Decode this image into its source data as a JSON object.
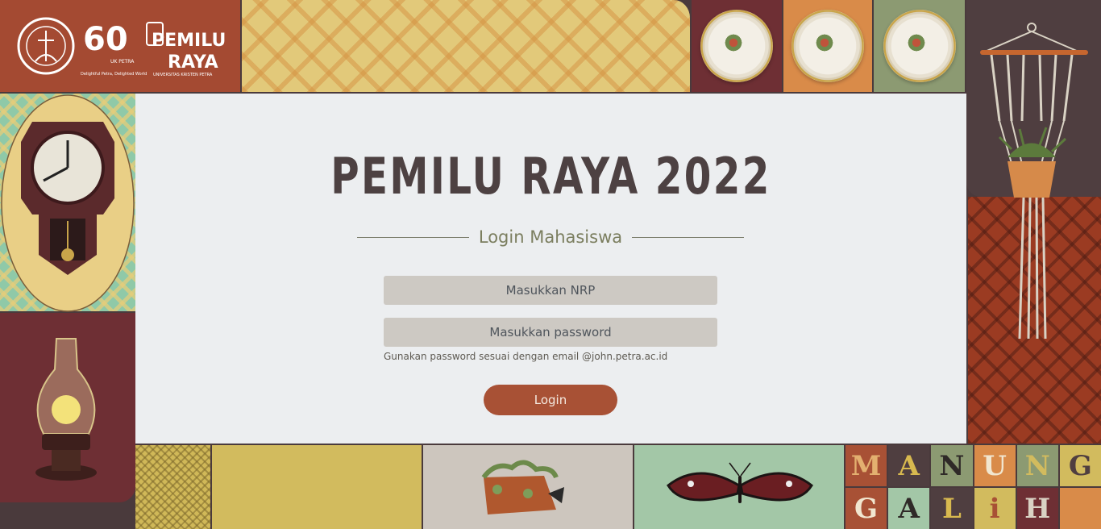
{
  "header": {
    "logos": [
      {
        "icon": "university-seal-icon",
        "text": "UNIVERSITAS KRISTEN PETRA"
      },
      {
        "icon": "sixty-anniversary-logo",
        "text": "60",
        "tag": "UK PETRA",
        "tagline": "Delightful Petra, Delighted World"
      },
      {
        "icon": "pemilu-raya-logo",
        "text": "PEMILU RAYA",
        "sub": "UNIVERSITAS KRISTEN PETRA"
      }
    ]
  },
  "main": {
    "title": "PEMILU RAYA 2022",
    "subtitle": "Login Mahasiswa",
    "nrp_placeholder": "Masukkan NRP",
    "password_placeholder": "Masukkan password",
    "hint": "Gunakan password sesuai dengan email @john.petra.ac.id",
    "login_label": "Login"
  },
  "footer": {
    "letters": [
      "M",
      "A",
      "N",
      "U",
      "N",
      "G",
      "G",
      "A",
      "L",
      "i",
      "H",
      ""
    ]
  },
  "colors": {
    "accent": "#a85135",
    "panel": "#eceef0",
    "frame": "#4a3a3c"
  }
}
